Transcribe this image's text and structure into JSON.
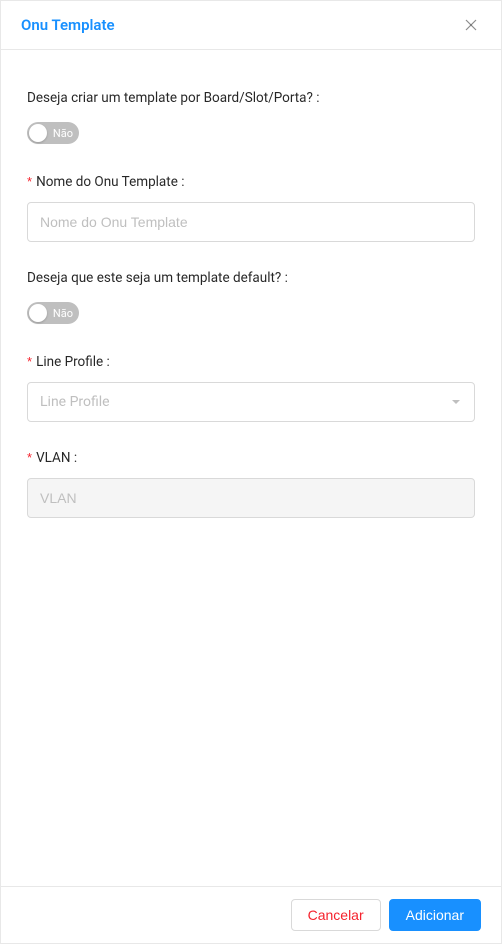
{
  "modal": {
    "title": "Onu Template"
  },
  "form": {
    "boardSlotPorta": {
      "label": "Deseja criar um template por Board/Slot/Porta? :",
      "toggleLabel": "Não"
    },
    "templateName": {
      "label": "Nome do Onu Template :",
      "placeholder": "Nome do Onu Template"
    },
    "defaultTemplate": {
      "label": "Deseja que este seja um template default? :",
      "toggleLabel": "Não"
    },
    "lineProfile": {
      "label": "Line Profile :",
      "placeholder": "Line Profile"
    },
    "vlan": {
      "label": "VLAN :",
      "placeholder": "VLAN"
    }
  },
  "footer": {
    "cancel": "Cancelar",
    "submit": "Adicionar"
  }
}
